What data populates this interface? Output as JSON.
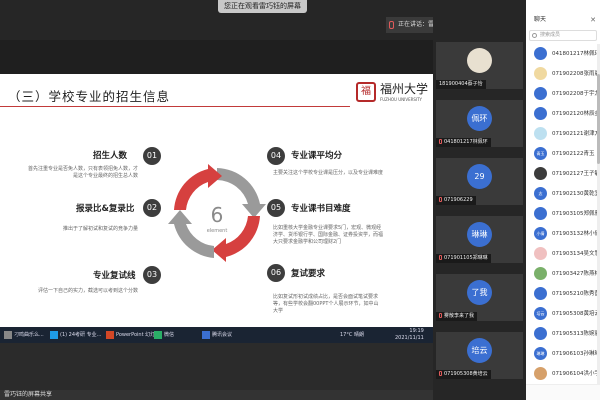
{
  "share_banner": {
    "chip_text": "您正在观看雷巧钰的屏幕",
    "speaking": "正在讲话：雷巧钰",
    "pin_icon": "pin-icon",
    "back_icon": "back-arrow-icon"
  },
  "slide": {
    "title": "（三）学校专业的招生信息",
    "logo_seal": "福",
    "logo_name": "福州大学",
    "logo_sub": "FUZHOU UNIVERSITY",
    "center_number": "6",
    "center_word": "element",
    "items": [
      {
        "num": "01",
        "title": "招生人数",
        "desc": "首先注重专业是否免人数，只有表领招免人数，才是这个专业最终的招生总人数"
      },
      {
        "num": "02",
        "title": "报录比&复录比",
        "desc": "推出于了解初试和复试的竞争力量"
      },
      {
        "num": "03",
        "title": "专业复试线",
        "desc": "评估一下自己的实力，截选可以考到这个分数"
      },
      {
        "num": "04",
        "title": "专业课平均分",
        "desc": "主要关注这个学校专业课是压分，以及专业课难度"
      },
      {
        "num": "05",
        "title": "专业课书目难度",
        "desc": "比如重核大学金融专业课要求5门，宏观、微观经济学、货币银行学、国际金融、证券投资学，而福大只要求金融学和公司理财2门"
      },
      {
        "num": "06",
        "title": "复试要求",
        "desc": "比如复试形初试成绩占比，是否会面试笔试要求等，有些学校会翻00PPT个人展示环节，如中山大学"
      }
    ],
    "colors": {
      "red": "#d6403f",
      "gray": "#9a9a9a",
      "accent": "#c23a3a"
    }
  },
  "taskbar": {
    "items": [
      {
        "label": "刁鸣曲乐么...",
        "icon": "app-icon"
      },
      {
        "label": "(1) 24考研 专业...",
        "icon": "qq-icon"
      },
      {
        "label": "PowerPoint 幻灯...",
        "icon": "powerpoint-icon"
      },
      {
        "label": "微信",
        "icon": "wechat-icon"
      },
      {
        "label": "腾讯会议",
        "icon": "tencent-meeting-icon"
      }
    ],
    "temperature": "17°C 晴朗",
    "time": "19:19",
    "date": "2021/11/11"
  },
  "bottom_bar": {
    "label": "雷巧钰的屏幕共享"
  },
  "video_tiles": [
    {
      "avatar": "",
      "label": "181900404蔡子怡",
      "avatar_color": "#e8e0d0",
      "muted": false
    },
    {
      "avatar": "佩环",
      "label": "041801217林佩环",
      "avatar_color": "#3b6fd1",
      "muted": true
    },
    {
      "avatar": "29",
      "label": "071906229",
      "avatar_color": "#3b6fd1",
      "muted": true
    },
    {
      "avatar": "琳琳",
      "label": "071901105郑琳琳",
      "avatar_color": "#3b6fd1",
      "muted": true
    },
    {
      "avatar": "了我",
      "label": "雾散李来了我",
      "avatar_color": "#3b6fd1",
      "muted": true
    },
    {
      "avatar": "培云",
      "label": "071905308黄培云",
      "avatar_color": "#3b6fd1",
      "muted": true
    }
  ],
  "chat": {
    "title": "聊天",
    "search_placeholder": "搜索成员",
    "members": [
      {
        "avatar": "",
        "name": "041801217林佩环",
        "avatar_color": "#3b6fd1"
      },
      {
        "avatar": "",
        "name": "071902208张雨晨",
        "avatar_color": "#f0d9a0"
      },
      {
        "avatar": "",
        "name": "071902208于宇龙",
        "avatar_color": "#3b6fd1"
      },
      {
        "avatar": "",
        "name": "071902120林辰金",
        "avatar_color": "#3b6fd1"
      },
      {
        "avatar": "",
        "name": "071902121谢津方",
        "avatar_color": "#bde0f0"
      },
      {
        "avatar": "青玉",
        "name": "071902122青玉",
        "avatar_color": "#3b6fd1"
      },
      {
        "avatar": "",
        "name": "071902127王子敏",
        "avatar_color": "#3c3c3c"
      },
      {
        "avatar": "志",
        "name": "071902130黄乾宜",
        "avatar_color": "#3b6fd1"
      },
      {
        "avatar": "",
        "name": "071903105郑佩雅",
        "avatar_color": "#3b6fd1"
      },
      {
        "avatar": "小倩",
        "name": "071903132林小倩",
        "avatar_color": "#3b6fd1"
      },
      {
        "avatar": "",
        "name": "071903134吴文慧",
        "avatar_color": "#f0c0c0"
      },
      {
        "avatar": "",
        "name": "071903427陈燕梅",
        "avatar_color": "#7ab06a"
      },
      {
        "avatar": "",
        "name": "071905210陈秀茵",
        "avatar_color": "#3b6fd1"
      },
      {
        "avatar": "培云",
        "name": "071905308黄培云",
        "avatar_color": "#3b6fd1"
      },
      {
        "avatar": "",
        "name": "071905313陈婉丽",
        "avatar_color": "#3b6fd1"
      },
      {
        "avatar": "琳琳",
        "name": "071906103孙琳琳",
        "avatar_color": "#3b6fd1"
      },
      {
        "avatar": "",
        "name": "071906104洪小宇",
        "avatar_color": "#d6a06a"
      }
    ]
  }
}
